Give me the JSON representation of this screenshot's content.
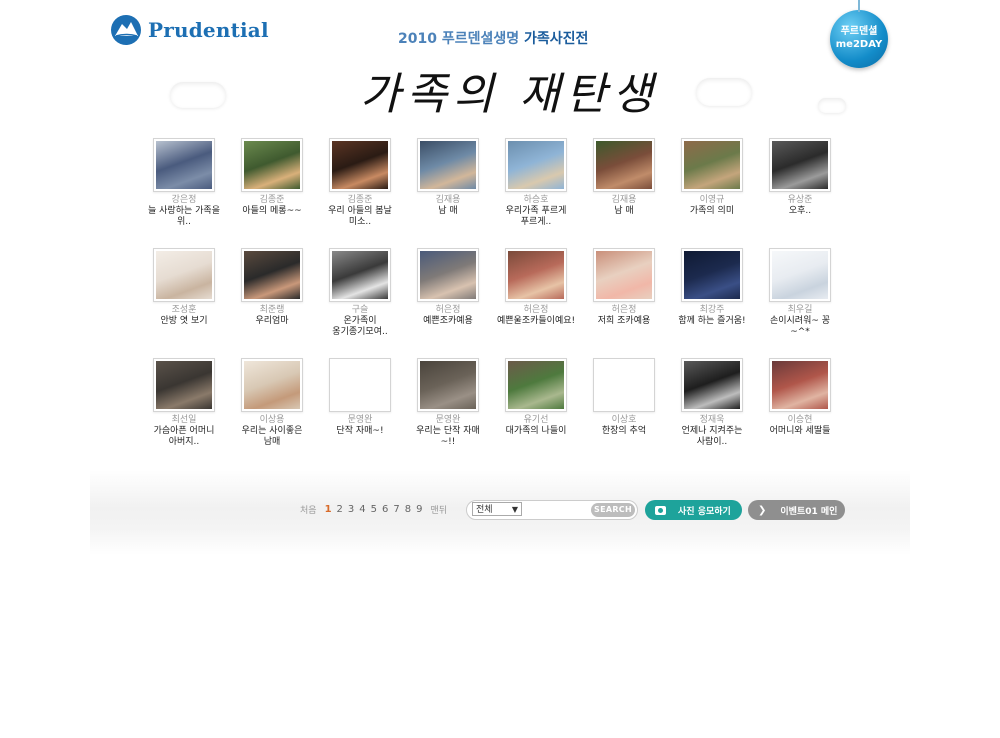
{
  "header": {
    "brand": "Prudential",
    "subtitle_prefix": "2010 푸르덴셜생명",
    "subtitle_accent": "가족사진전",
    "hand_title": "가족의 재탄생",
    "me2day_line1": "푸르덴셜",
    "me2day_line2": "me2DAY"
  },
  "photos": [
    {
      "author": "강은정",
      "caption": "늘 사랑하는 가족을 위..",
      "palette": [
        "#4a5b7e",
        "#7c8da8",
        "#b8c2d0"
      ]
    },
    {
      "author": "김종준",
      "caption": "아들의 메롱~~",
      "palette": [
        "#3f5a2f",
        "#d9b07a",
        "#6b8a4e"
      ]
    },
    {
      "author": "김종준",
      "caption": "우리 아들의 봄날 미소..",
      "palette": [
        "#2a1b14",
        "#c88a62",
        "#5b3524"
      ]
    },
    {
      "author": "김재용",
      "caption": "남 매",
      "palette": [
        "#6e8aa6",
        "#d2b79a",
        "#3b4e66"
      ]
    },
    {
      "author": "하승호",
      "caption": "우리가족 푸르게 푸르게..",
      "palette": [
        "#8fb4d6",
        "#d9c9ae",
        "#6c8fae"
      ]
    },
    {
      "author": "김재용",
      "caption": "남 매",
      "palette": [
        "#7a4d3a",
        "#c08c6a",
        "#3d5a2c"
      ]
    },
    {
      "author": "이영규",
      "caption": "가족의 의미",
      "palette": [
        "#6b7a4a",
        "#c4a57c",
        "#8e6a4a"
      ]
    },
    {
      "author": "유상준",
      "caption": "오후..",
      "palette": [
        "#2b2b2b",
        "#9b9b9b",
        "#5a5a5a"
      ]
    },
    {
      "author": "조성훈",
      "caption": "안방 엿 보기",
      "palette": [
        "#e6dcd2",
        "#c9b4a0",
        "#f3ede6"
      ]
    },
    {
      "author": "최준랭",
      "caption": "우리엄마",
      "palette": [
        "#2a2a2a",
        "#c9987a",
        "#5a4a3e"
      ]
    },
    {
      "author": "구슬",
      "caption": "온가족이 옹기종기모여..",
      "palette": [
        "#3a3a3a",
        "#e4e4e4",
        "#8a8a8a"
      ]
    },
    {
      "author": "허은정",
      "caption": "예쁜조카예용",
      "palette": [
        "#7f7a78",
        "#d8c2b0",
        "#4a5a7a"
      ]
    },
    {
      "author": "허은정",
      "caption": "예쁜울조카들이예요!",
      "palette": [
        "#b86a5a",
        "#e7c3a6",
        "#7a4a3a"
      ]
    },
    {
      "author": "허은정",
      "caption": "저희 조카예용",
      "palette": [
        "#e8d0c0",
        "#f1b7a8",
        "#c98f7a"
      ]
    },
    {
      "author": "최강주",
      "caption": "함께 하는 즐거움!",
      "palette": [
        "#1c2a4e",
        "#3a4f86",
        "#0f1a33"
      ]
    },
    {
      "author": "최우길",
      "caption": "손이시려워~ 꽁~^*",
      "palette": [
        "#e8ecf1",
        "#c9d3de",
        "#f6f8fa"
      ]
    },
    {
      "author": "최선일",
      "caption": "가슴아픈 어머니 아버지..",
      "palette": [
        "#3a3632",
        "#8a7a6a",
        "#5a524a"
      ]
    },
    {
      "author": "이상용",
      "caption": "우리는 사이좋은 남매",
      "palette": [
        "#d8c8b4",
        "#c49a7a",
        "#efe6da"
      ]
    },
    {
      "author": "문영완",
      "caption": "단작 자매~!",
      "palette": [
        "#ffffff",
        "#ffffff",
        "#ffffff"
      ]
    },
    {
      "author": "문영완",
      "caption": "우리는 단작 자매~!!",
      "palette": [
        "#6a6258",
        "#9a9086",
        "#4a443c"
      ]
    },
    {
      "author": "유기선",
      "caption": "대가족의 나들이",
      "palette": [
        "#4e7a3e",
        "#a9b88e",
        "#6c5a4a"
      ]
    },
    {
      "author": "이상호",
      "caption": "한장의 추억",
      "palette": [
        "#ffffff",
        "#ffffff",
        "#ffffff"
      ]
    },
    {
      "author": "정재욱",
      "caption": "언제나 지켜주는 사람이..",
      "palette": [
        "#1e1e1e",
        "#bdbdbd",
        "#5a5a5a"
      ]
    },
    {
      "author": "이승현",
      "caption": "어머니와 세딸들",
      "palette": [
        "#b0564a",
        "#e0b4a2",
        "#6a3a3a"
      ]
    }
  ],
  "pagination": {
    "first_label": "처음",
    "pages": [
      "1",
      "2",
      "3",
      "4",
      "5",
      "6",
      "7",
      "8",
      "9"
    ],
    "current": "1",
    "last_label": "맨뒤"
  },
  "search": {
    "select_value": "전체",
    "input_value": "",
    "button_label": "SEARCH"
  },
  "actions": {
    "apply_label": "사진 응모하기",
    "main_label": "이벤트01 메인"
  },
  "colors": {
    "brand_blue": "#1d6fb3",
    "apply_teal": "#1ea39b",
    "main_gray": "#8f8f8f",
    "active_page": "#d86b2a"
  },
  "icons": [
    "prudential-rock-logo-icon",
    "photo-icon",
    "arrow-right-icon",
    "caret-down-icon"
  ]
}
